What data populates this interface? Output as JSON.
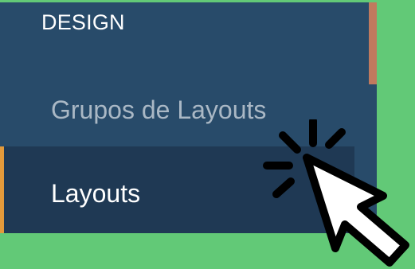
{
  "sidebar": {
    "section_header": "DESIGN",
    "items": [
      {
        "label": "Grupos de Layouts",
        "active": false
      },
      {
        "label": "Layouts",
        "active": true
      }
    ]
  },
  "colors": {
    "background": "#62c977",
    "panel": "#284b6a",
    "active_item_bg": "#1f3954",
    "active_indicator": "#e39a3b",
    "scroll_accent": "#c07a5e",
    "header_text": "#ffffff",
    "item_text": "#aab8c5",
    "active_text": "#ffffff",
    "cursor_fill": "#ffffff",
    "cursor_stroke": "#000000"
  },
  "icons": {
    "cursor": "pointer-click-icon"
  }
}
